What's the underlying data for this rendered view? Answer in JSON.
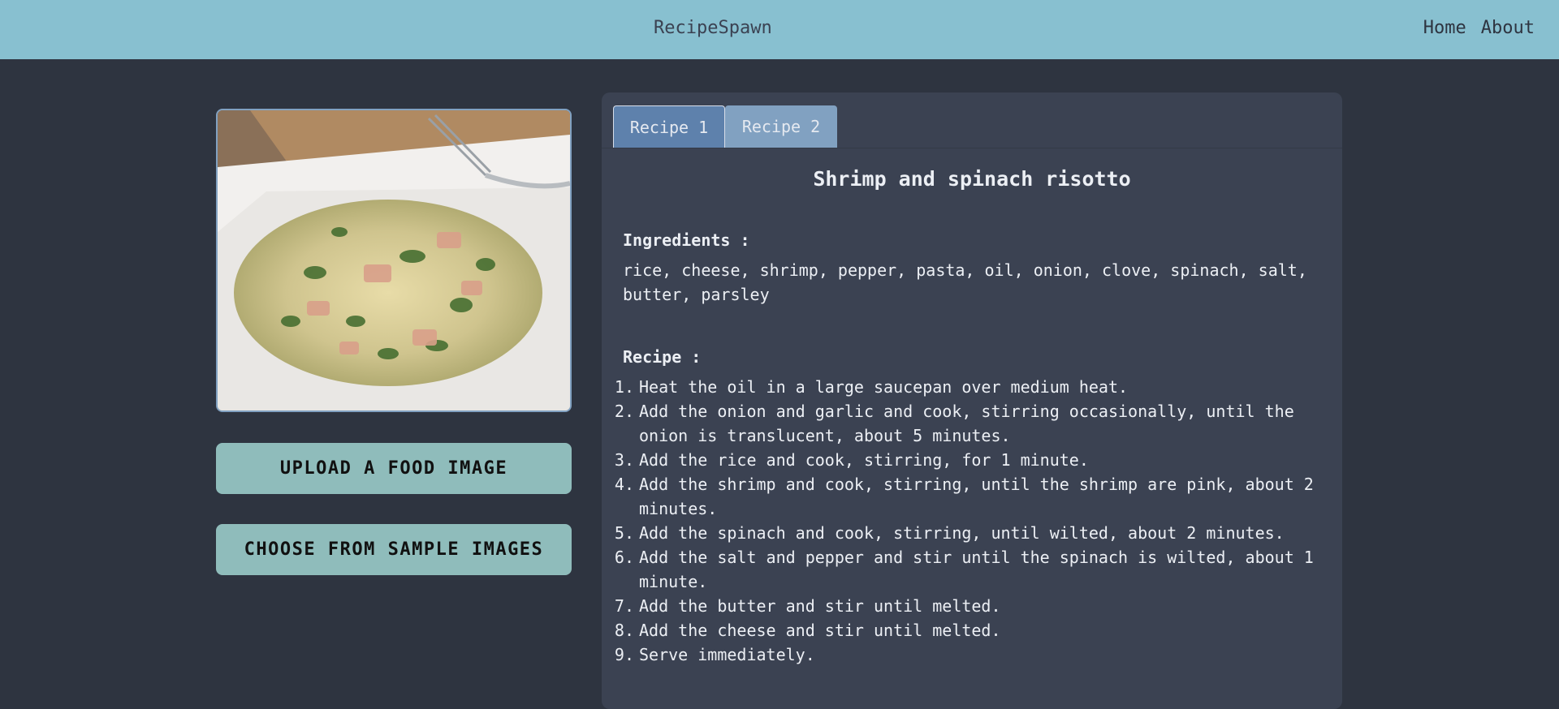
{
  "app": {
    "brand": "RecipeSpawn"
  },
  "nav": {
    "home": "Home",
    "about": "About"
  },
  "actions": {
    "upload": "UPLOAD A FOOD IMAGE",
    "sample": "CHOOSE FROM SAMPLE IMAGES"
  },
  "tabs": [
    {
      "label": "Recipe 1",
      "active": true
    },
    {
      "label": "Recipe 2",
      "active": false
    }
  ],
  "recipe": {
    "title": "Shrimp and spinach risotto",
    "ingredients_label": "Ingredients :",
    "ingredients": "rice, cheese, shrimp, pepper, pasta, oil, onion, clove, spinach, salt, butter, parsley",
    "steps_label": "Recipe :",
    "steps": [
      {
        "n": "1.",
        "text": "Heat the oil in a large saucepan over medium heat."
      },
      {
        "n": "2.",
        "text": "Add the onion and garlic and cook, stirring occasionally, until the onion is translucent, about 5 minutes."
      },
      {
        "n": "3.",
        "text": "Add the rice and cook, stirring, for 1 minute."
      },
      {
        "n": "4.",
        "text": "Add the shrimp and cook, stirring, until the shrimp are pink, about 2 minutes."
      },
      {
        "n": "5.",
        "text": "Add the spinach and cook, stirring, until wilted, about 2 minutes."
      },
      {
        "n": "6.",
        "text": "Add the salt and pepper and stir until the spinach is wilted, about 1 minute."
      },
      {
        "n": "7.",
        "text": "Add the butter and stir until melted."
      },
      {
        "n": "8.",
        "text": "Add the cheese and stir until melted."
      },
      {
        "n": "9.",
        "text": "Serve immediately."
      }
    ]
  },
  "colors": {
    "navbar": "#88c0d0",
    "background": "#2e3440",
    "panel": "#3b4252",
    "button": "#8fbcbb",
    "tab_active": "#5e81ac",
    "tab_inactive": "#81a1c1"
  }
}
